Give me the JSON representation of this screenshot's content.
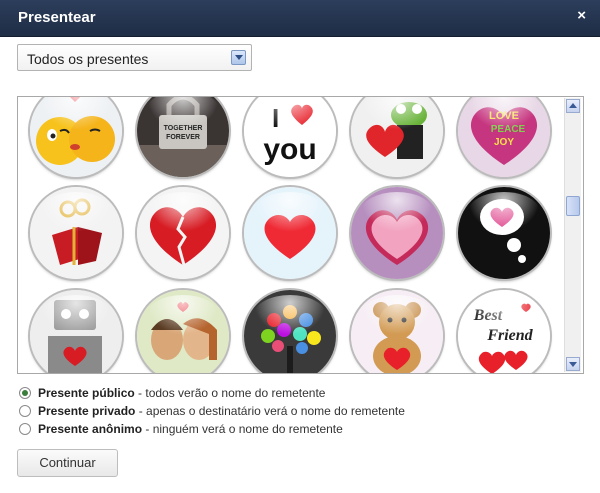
{
  "dialog": {
    "title": "Presentear",
    "close_glyph": "×"
  },
  "filter": {
    "selected": "Todos os presentes"
  },
  "gifts": [
    {
      "name": "kissing-emoticons-gift"
    },
    {
      "name": "padlock-together-forever-gift",
      "text1": "TOGETHER",
      "text2": "FOREVER"
    },
    {
      "name": "i-love-you-gift",
      "text1": "I",
      "text2": "you"
    },
    {
      "name": "frog-with-heart-gift"
    },
    {
      "name": "love-peace-joy-heart-gift",
      "text1": "LOVE",
      "text2": "PEACE",
      "text3": "JOY"
    },
    {
      "name": "gift-box-hearts-gift"
    },
    {
      "name": "broken-heart-gift"
    },
    {
      "name": "red-heart-gift"
    },
    {
      "name": "pink-heart-gift"
    },
    {
      "name": "thought-bubble-heart-gift"
    },
    {
      "name": "robot-heart-gift"
    },
    {
      "name": "couple-kiss-gift"
    },
    {
      "name": "heart-tree-gift"
    },
    {
      "name": "teddy-bear-gift"
    },
    {
      "name": "best-friend-gift",
      "text1": "Best",
      "text2": "Friend"
    }
  ],
  "privacy": [
    {
      "label": "Presente público",
      "desc": " - todos verão o nome do remetente",
      "checked": true
    },
    {
      "label": "Presente privado",
      "desc": " - apenas o destinatário verá o nome do remetente",
      "checked": false
    },
    {
      "label": "Presente anônimo",
      "desc": " - ninguém verá o nome do remetente",
      "checked": false
    }
  ],
  "submit": {
    "label": "Continuar"
  },
  "colors": {
    "titlebar": "#253550",
    "accent": "#e8202a"
  }
}
